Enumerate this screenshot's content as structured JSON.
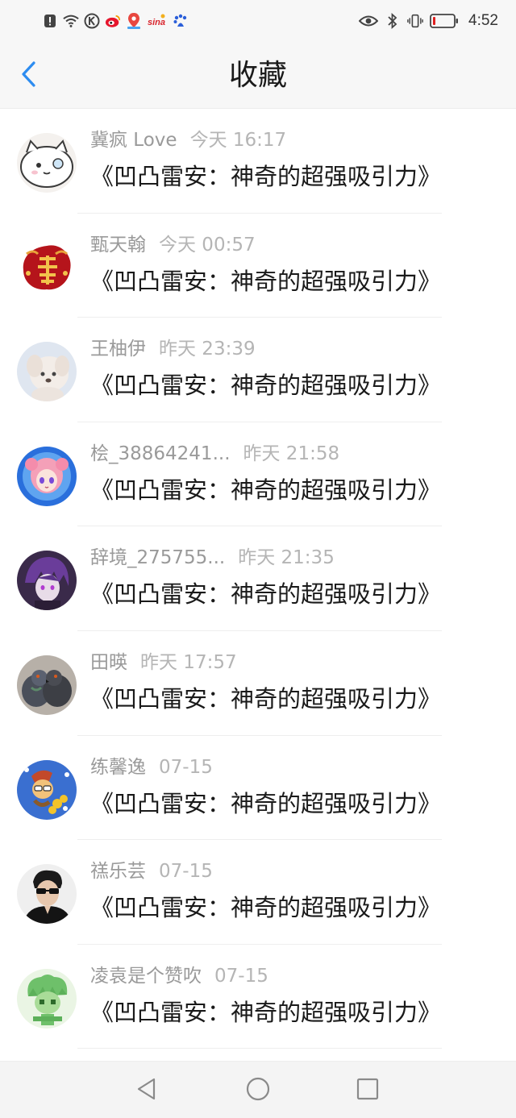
{
  "status_bar": {
    "time": "4:52",
    "icons_left": [
      "alert-icon",
      "wifi-icon",
      "k-app-icon",
      "weibo-icon",
      "map-pin-icon",
      "sina-icon",
      "baidu-icon"
    ],
    "icons_right": [
      "eye-icon",
      "bluetooth-icon",
      "vibrate-icon",
      "battery-icon"
    ],
    "sina_label": "sina"
  },
  "header": {
    "title": "收藏",
    "back_icon": "chevron-left-icon",
    "accent_color": "#2d8cf0"
  },
  "favorites": [
    {
      "name": "冀疯 Love",
      "time": "今天 16:17",
      "title": "《凹凸雷安：神奇的超强吸引力》",
      "avatar": "cat-avatar"
    },
    {
      "name": "甄天翰",
      "time": "今天 00:57",
      "title": "《凹凸雷安：神奇的超强吸引力》",
      "avatar": "fu-avatar"
    },
    {
      "name": "王柚伊",
      "time": "昨天 23:39",
      "title": "《凹凸雷安：神奇的超强吸引力》",
      "avatar": "puppy-avatar"
    },
    {
      "name": "桧_38864241...",
      "time": "昨天 21:58",
      "title": "《凹凸雷安：神奇的超强吸引力》",
      "avatar": "anime-girl-avatar"
    },
    {
      "name": "辞境_275755...",
      "time": "昨天 21:35",
      "title": "《凹凸雷安：神奇的超强吸引力》",
      "avatar": "anime-boy-avatar"
    },
    {
      "name": "田暎",
      "time": "昨天 17:57",
      "title": "《凹凸雷安：神奇的超强吸引力》",
      "avatar": "pigeon-avatar"
    },
    {
      "name": "练馨逸",
      "time": "07-15",
      "title": "《凹凸雷安：神奇的超强吸引力》",
      "avatar": "cartoon-avatar"
    },
    {
      "name": "禚乐芸",
      "time": "07-15",
      "title": "《凹凸雷安：神奇的超强吸引力》",
      "avatar": "sunglasses-avatar"
    },
    {
      "name": "凌袁是个赞吹",
      "time": "07-15",
      "title": "《凹凸雷安：神奇的超强吸引力》",
      "avatar": "green-character-avatar"
    }
  ],
  "nav_bar": {
    "buttons": [
      "back-triangle-icon",
      "home-circle-icon",
      "recent-square-icon"
    ]
  }
}
